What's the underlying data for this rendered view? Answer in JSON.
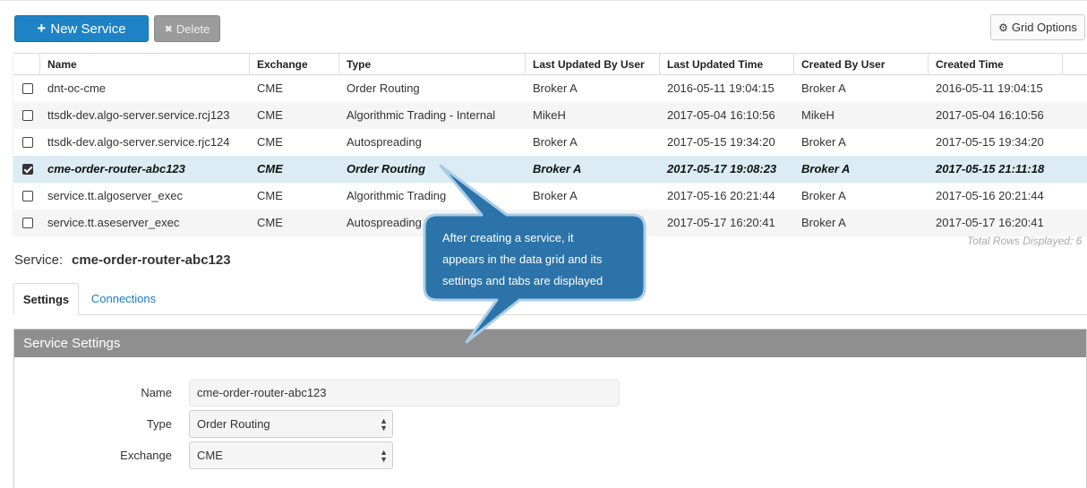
{
  "toolbar": {
    "new_service": "New Service",
    "delete": "Delete",
    "grid_options": "Grid Options"
  },
  "grid": {
    "columns": [
      "Name",
      "Exchange",
      "Type",
      "Last Updated By User",
      "Last Updated Time",
      "Created By User",
      "Created Time"
    ],
    "rows": [
      {
        "name": "dnt-oc-cme",
        "exchange": "CME",
        "type": "Order Routing",
        "updated_by": "Broker A",
        "updated_time": "2016-05-11 19:04:15",
        "created_by": "Broker A",
        "created_time": "2016-05-11 19:04:15",
        "checked": false
      },
      {
        "name": "ttsdk-dev.algo-server.service.rcj123",
        "exchange": "CME",
        "type": "Algorithmic Trading - Internal",
        "updated_by": "MikeH",
        "updated_time": "2017-05-04 16:10:56",
        "created_by": "MikeH",
        "created_time": "2017-05-04 16:10:56",
        "checked": false
      },
      {
        "name": "ttsdk-dev.algo-server.service.rjc124",
        "exchange": "CME",
        "type": "Autospreading",
        "updated_by": "Broker A",
        "updated_time": "2017-05-15 19:34:20",
        "created_by": "Broker A",
        "created_time": "2017-05-15 19:34:20",
        "checked": false
      },
      {
        "name": "cme-order-router-abc123",
        "exchange": "CME",
        "type": "Order Routing",
        "updated_by": "Broker A",
        "updated_time": "2017-05-17 19:08:23",
        "created_by": "Broker A",
        "created_time": "2017-05-15 21:11:18",
        "checked": true
      },
      {
        "name": "service.tt.algoserver_exec",
        "exchange": "CME",
        "type": "Algorithmic Trading",
        "updated_by": "Broker A",
        "updated_time": "2017-05-16 20:21:44",
        "created_by": "Broker A",
        "created_time": "2017-05-16 20:21:44",
        "checked": false
      },
      {
        "name": "service.tt.aseserver_exec",
        "exchange": "CME",
        "type": "Autospreading",
        "updated_by": "",
        "updated_time": "2017-05-17 16:20:41",
        "created_by": "Broker A",
        "created_time": "2017-05-17 16:20:41",
        "checked": false
      }
    ],
    "total_rows": "Total Rows Displayed: 6"
  },
  "service": {
    "label": "Service:",
    "name": "cme-order-router-abc123"
  },
  "tabs": {
    "settings": "Settings",
    "connections": "Connections"
  },
  "settings_panel": {
    "title": "Service Settings",
    "name_label": "Name",
    "name_value": "cme-order-router-abc123",
    "type_label": "Type",
    "type_value": "Order Routing",
    "exchange_label": "Exchange",
    "exchange_value": "CME"
  },
  "callout": {
    "line1": "After creating a service, it",
    "line2": "appears in the data grid and its",
    "line3": "settings and tabs are displayed"
  },
  "colors": {
    "primary": "#1d83c5",
    "selected_row": "#dbecf4",
    "panel_header": "#8f8f8f",
    "callout_fill": "#2b73a8"
  }
}
